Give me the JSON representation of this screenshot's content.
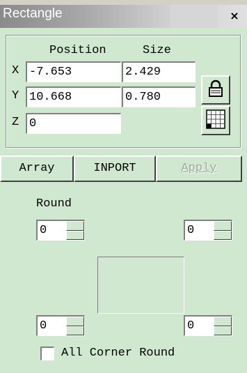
{
  "window": {
    "title": "Rectangle",
    "close_glyph": "×"
  },
  "transform": {
    "position_header": "Position",
    "size_header": "Size",
    "x_label": "X",
    "y_label": "Y",
    "z_label": "Z",
    "position_x": "-7.653",
    "position_y": "10.668",
    "position_z": "0",
    "size_x": "2.429",
    "size_y": "0.780",
    "lock_icon": "lock-icon",
    "grid_icon": "grid-icon"
  },
  "actions": {
    "array_label": "Array",
    "import_label": "INPORT",
    "apply_label": "Apply"
  },
  "round": {
    "label": "Round",
    "top_left": "0",
    "top_right": "0",
    "bottom_left": "0",
    "bottom_right": "0",
    "all_corner_label": "All Corner Round",
    "all_corner_checked": false
  },
  "colors": {
    "panel_bg": "#cfe8cf",
    "title_start": "#8a8a8a",
    "title_end": "#e0e0e0"
  }
}
